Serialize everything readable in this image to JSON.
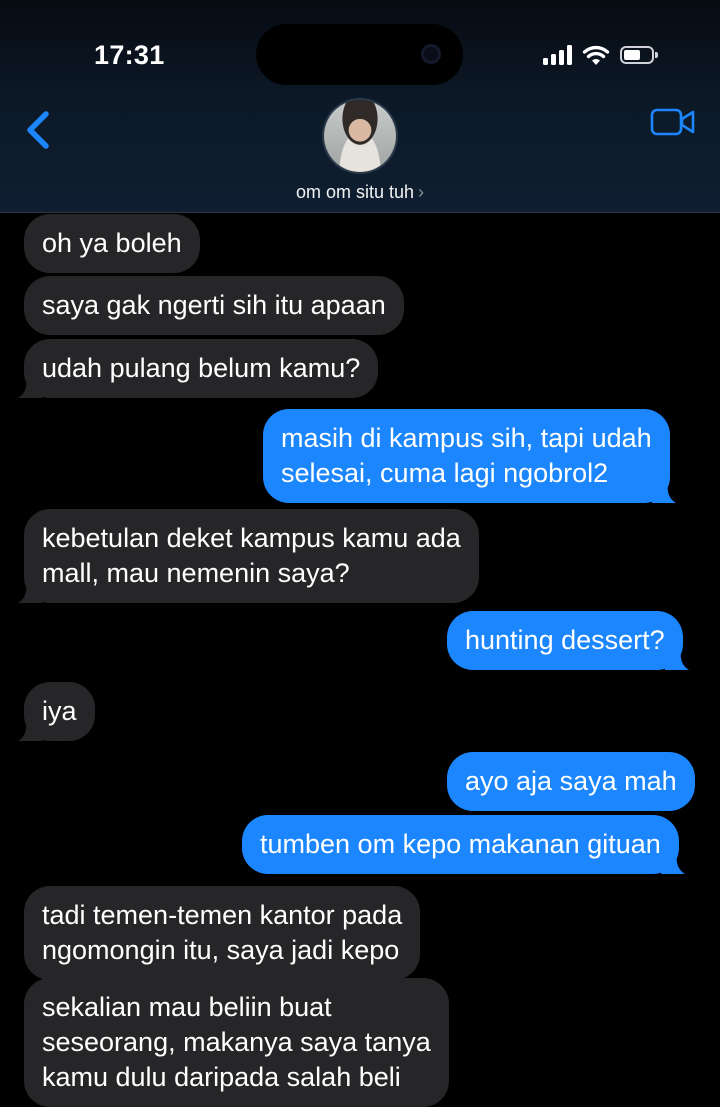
{
  "status_bar": {
    "time": "17:31"
  },
  "contact": {
    "name": "om om situ tuh",
    "chevron": "›"
  },
  "icons": {
    "back": "chevron-left-icon",
    "video": "video-camera-icon",
    "signal": "signal-icon",
    "wifi": "wifi-icon",
    "battery": "battery-icon"
  },
  "colors": {
    "accent": "#1b86fe",
    "received_bubble": "#262628",
    "background": "#000000"
  },
  "messages": [
    {
      "from": "them",
      "lines": [
        "oh ya boleh"
      ]
    },
    {
      "from": "them",
      "lines": [
        "saya gak ngerti sih itu apaan"
      ]
    },
    {
      "from": "them",
      "lines": [
        "udah pulang belum kamu?"
      ]
    },
    {
      "from": "me",
      "lines": [
        "masih di kampus sih, tapi udah",
        "selesai, cuma lagi ngobrol2"
      ]
    },
    {
      "from": "them",
      "lines": [
        "kebetulan deket kampus kamu ada",
        "mall, mau nemenin saya?"
      ]
    },
    {
      "from": "me",
      "lines": [
        "hunting dessert?"
      ]
    },
    {
      "from": "them",
      "lines": [
        "iya"
      ]
    },
    {
      "from": "me",
      "lines": [
        "ayo aja saya mah"
      ]
    },
    {
      "from": "me",
      "lines": [
        "tumben om kepo makanan gituan"
      ]
    },
    {
      "from": "them",
      "lines": [
        "tadi temen-temen kantor pada",
        "ngomongin itu, saya jadi kepo"
      ]
    },
    {
      "from": "them",
      "lines": [
        "sekalian mau beliin buat",
        "seseorang, makanya saya tanya",
        "kamu dulu daripada salah beli"
      ]
    }
  ]
}
